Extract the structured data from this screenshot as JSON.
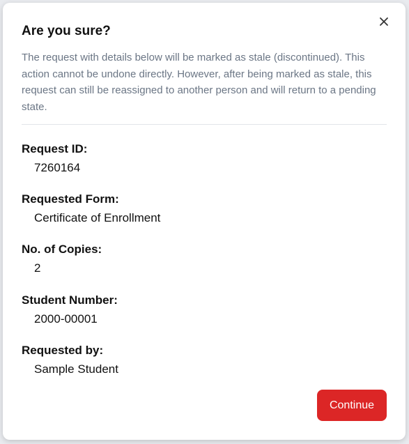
{
  "dialog": {
    "title": "Are you sure?",
    "description": "The request with details below will be marked as stale (discontinued). This action cannot be undone directly. However, after being marked as stale, this request can still be reassigned to another person and will return to a pending state.",
    "close_icon": "close-icon",
    "continue_label": "Continue"
  },
  "details": [
    {
      "label": "Request ID:",
      "value": "7260164"
    },
    {
      "label": "Requested Form:",
      "value": "Certificate of Enrollment"
    },
    {
      "label": "No. of Copies:",
      "value": "2"
    },
    {
      "label": "Student Number:",
      "value": "2000-00001"
    },
    {
      "label": "Requested by:",
      "value": "Sample Student"
    }
  ],
  "colors": {
    "accent": "#dc2626",
    "description_text": "#6b7685",
    "text": "#111111"
  }
}
